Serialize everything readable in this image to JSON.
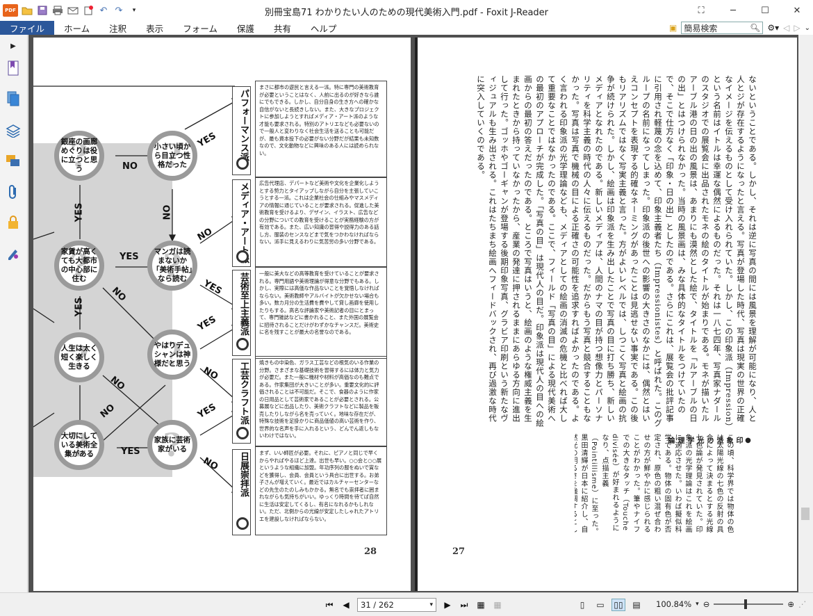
{
  "window": {
    "title": "別冊宝島71 わかりたい人のための現代美術入門.pdf - Foxit J-Reader",
    "app_logo": "PDF"
  },
  "menu": {
    "items": [
      "ファイル",
      "ホーム",
      "注釈",
      "表示",
      "フォーム",
      "保護",
      "共有",
      "ヘルプ"
    ],
    "active_index": 0
  },
  "search": {
    "value": "簡易検索"
  },
  "left_page": {
    "page_number": "28",
    "nodes": [
      "銀座の画廊めぐりは役に立つと思う",
      "小さい頃から目立つ性格だった",
      "家賃が高くても大都市の中心部に住む",
      "マンガは読まないか「美術手帖」なら読む",
      "人生は太く短く楽しく生きる",
      "やはりデュシャンは神様だと思う",
      "大切にしている美術全集がある",
      "家族に芸術家がいる"
    ],
    "answers": {
      "yes": "YES",
      "no": "NO"
    },
    "categories": [
      {
        "title": "パフォーマンス派",
        "text": "まさに都市の遊民と言える一派。特に専門の美術教育が必要ということはなく、人前に出るのが好きなら誰にでもできる。しかし、自分自身の生き方への確かな自信がないと長続きしない。また、大きなプロジェクトに参加しようとすればメディア・アート派のような才能も要求される。特別のアトリエなども必要ないので一般人と変わりなく社会生活を送ることも可能だが、最も資本投下の必要がない分野だが結果も未知数なので、文化動物などに興味のある人には読められない。"
      },
      {
        "title": "メディア・アート派",
        "text": "広告代理店、デパートなど美術や文化を企業化しようとする勢力とタイアップしながら自分を主張していこうとする一派。これは企業社会の仕組みやマスメディアの情報に通じていることが要求される。促進した美術教育を受けるより、デザイン、イラスト、広告などの分野についての教育を受けることが実務経験の方が有効である。また、広い知識の習得や説得力のある話し方、服装のセンスなどまで気をつかわなければならない。派手に見えるわりに気苦労の多い分野である。"
      },
      {
        "title": "芸術至上主義派",
        "text": "一般に美大などの高等教育を受けていることが要求される。専門用語や美術理論が得意な分野でもある。しかし、実際には高価な作品ないことを覚悟しなければならない。美術教師やアルバイトが欠かせない場合も多い。数カ月分の生活費を費やして貸し画廊を使用したりもする。高名な評論家や美術記者の目にとまって、専門雑誌などに書かれること、また外国の展覧会に招待されることだけがわずかなチャンスだ。美術史に名を残すことが最大の名誉なのである。"
      },
      {
        "title": "工芸クラフト派",
        "text": "焼きもの中染色、ガラス工芸などの根気のいる作業の分野。さまざまな基礎技術を習得するには体力と気力が必要だ。また一般に機材や材料が高価なのも難点である。作家集団が大きいことが多い。重要文化的に評価されることは不可能だ。そこで、食器のように作家の日用品として芸術家であることが必要とされる。公募展などに出品したり、美術クラフトなどに製品を販売したりしながら名を売っていく。地味な存在だが、特殊な技術を足掛かりに商品価値の高い芸術を作り、世界的な名声を手に入れるという、どんでん返しもないわけではない。"
      },
      {
        "title": "日展崇拝派",
        "text": "まず、いい師匠が必要。それに、ピアノと同じで早くからやればやるほど上達。出世も早い。○○会と○○展というような組織に加盟。年功序列の服をぬいで賞などを獲得し、会員、会員という具合に出世する。お弟子さんが増えていく。最近ではカルチャーセンターなどの先生のたのしみもかかる。無名でも崇拝者に囲まれながらも気持ちがいい。ゆっくり時間を待てば自然に生活は安定してくるし、有名になれるかもしれない。ただ、北側からの光線が安定したしゃれたアトリエを建設しなければならない。"
      }
    ]
  },
  "right_page": {
    "page_number": "27",
    "column_text": "ないということである。しかし、それは逆に写真の間には風景を理解が可能になり、人と人とジが存在するようになったと言える。写真が登場した時代、写真は現実の世界の正確なイメージを伝えるものとして受け入れられていた。しかし、この印象派（Impression）という名前はイトルは幸運な偶然によるものだった。それは一八七四年、写真家ナダールのスタジオでの展覧会に出品されたモネの絵のタイトルが始まりである。モネが描いたルアーブル港の日の出の風景は、あまりにも漠然とした絵で、タイトルを「ルアーブルの日の出」とはつけられなかった。当時の風景画は、みな具体的なタイトルをつけていたので、そこで仕方なく「印象・日の出」としたのである。さらにこれは、展覧会の批評記事に引用され軽蔑の念を込めて、印象主義者たち（Impressionistes）と呼ばれた。このグループの名前になってしまった。印象派の後世への影響の大きさのなかには、偶然とはいえコンセプトを表現する的確なネーミングがあったことは見逃せない事実である。この後もリアリズムではなく写実主義と言った。方がよいレベルでは、しつこく写真と絵画の抗争が続けられた。しかし、絵画は印象派を生み出したことで写真の目に打ち勝ち、新しいメディアとなれたのである。新しいメディアは、人間のナマの目が持つ想像力とパーソナリティを科学主義の時代の人々に伝えるものだった。だからもう写真と競合することもなかった。写真は写真で機械の目による正確さの可能性を追求すればよかったのである。よく言われる印象派の光学理論なども、メディアとしての絵画の消滅の危機と比べれば大して重要なことではなかったのである。ここで、フィールド「写真の目」による現代美術への最初のアプローチが完成した。「写真の目」は現代人の目だ。印象派は現代人の目への絵画からの最初の答えだったのである。ところで写真はいうと、絵画のような権威主義を生まれたときから持っていなかったから、産業の発達に押されるままにあらゆる方向に進出して行った。ゴッホやゴーギャンが登場する後期印象写真、グラビア印刷という新たなヴィジュアルも生み出される。これはたちまち絵画へフィードバックされ、再び過激な時代に突入していくのである。",
    "sidebar_heading": "●印象派の光学理論",
    "sidebar_text": "この頃、科学界では物体の色は太陽光線の七色の反射の具合によって決まるとする光線七色論が発見されていた。印象派の光学理論はこれを絵画に適応させた。いわば擬似科学である。物体の固有色が否定され、原色の粗い混ぜ合わせの方が鮮やかに感じられることがわかった。筆やナイフでの大きなタッチ（Touche divisée）が好まれるようになり、点描主義（Pointillisme）に至った。黒田清輝が日本に紹介し、自然光の明るさを強調するとして外光派、または彼らがむらさきでかなかったことから、紫に陰影に黒を使わなかったことから、むらさき派と呼ばれた。"
  },
  "status": {
    "page_display": "31 / 262",
    "zoom": "100.84%"
  },
  "icons": {
    "qat": [
      "open-folder-icon",
      "save-icon",
      "print-icon",
      "email-icon",
      "new-icon",
      "undo-icon",
      "redo-icon",
      "dropdown-icon"
    ],
    "left_panel": [
      "bookmark-icon",
      "pages-icon",
      "layers-icon",
      "comments-icon",
      "attachments-icon",
      "security-icon",
      "signature-icon"
    ]
  }
}
